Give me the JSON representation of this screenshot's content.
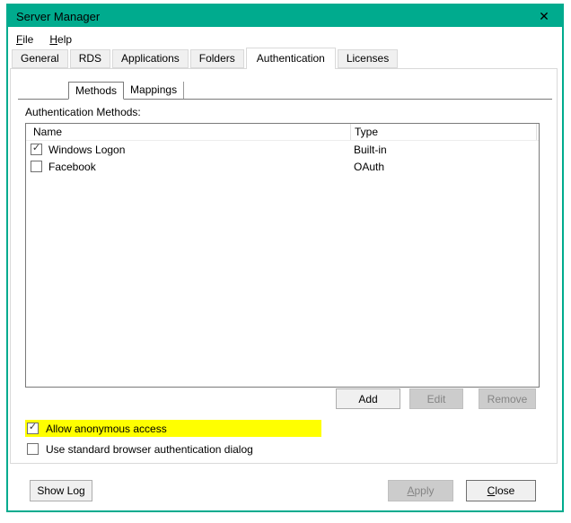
{
  "window": {
    "title": "Server Manager",
    "close_glyph": "✕",
    "accent_color": "#00AB8E"
  },
  "menu": {
    "file": {
      "accel": "F",
      "rest": "ile"
    },
    "help": {
      "accel": "H",
      "rest": "elp"
    }
  },
  "tabs": {
    "selected": "Authentication",
    "items": [
      "General",
      "RDS",
      "Applications",
      "Folders",
      "Authentication",
      "Licenses"
    ]
  },
  "subtabs": {
    "selected": "Methods",
    "items": [
      "Methods",
      "Mappings"
    ]
  },
  "methods": {
    "label": "Authentication Methods:",
    "columns": [
      "Name",
      "Type"
    ],
    "rows": [
      {
        "name": "Windows Logon",
        "type": "Built-in",
        "checked": true
      },
      {
        "name": "Facebook",
        "type": "OAuth",
        "checked": false
      }
    ],
    "add_label": "Add",
    "edit_label": "Edit",
    "remove_label": "Remove",
    "edit_enabled": false,
    "remove_enabled": false,
    "allow_anonymous": {
      "label": "Allow anonymous access",
      "checked": true,
      "highlight_color": "#FFFF00"
    },
    "standard_browser": {
      "label": "Use standard browser authentication dialog",
      "checked": false
    }
  },
  "footer": {
    "show_log": "Show Log",
    "apply": {
      "accel": "A",
      "rest": "pply",
      "enabled": false
    },
    "close": {
      "accel": "C",
      "rest": "lose",
      "enabled": true
    }
  },
  "icons": {
    "check": "✓"
  }
}
